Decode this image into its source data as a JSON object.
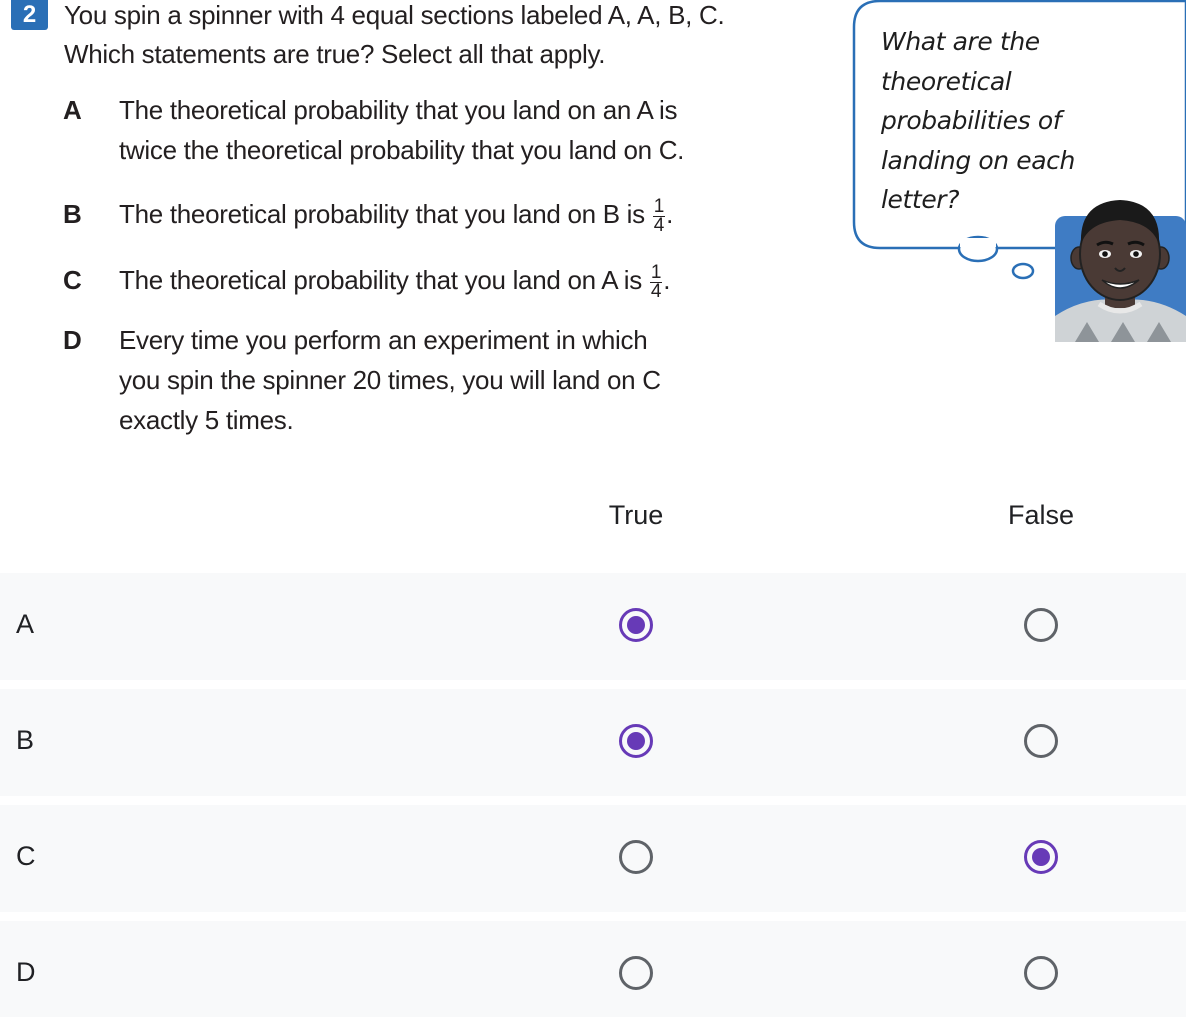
{
  "question": {
    "number": "2",
    "stem_line1": "You spin a spinner with 4 equal sections labeled A, A, B, C.",
    "stem_line2": "Which statements are true? Select all that apply.",
    "options": [
      {
        "letter": "A",
        "line1": "The theoretical probability that you land on an A is",
        "line2": "twice the theoretical probability that you land on C."
      },
      {
        "letter": "B",
        "text": "The theoretical probability that you land on B is",
        "frac_num": "1",
        "frac_den": "4",
        "suffix": "."
      },
      {
        "letter": "C",
        "text": "The theoretical probability that you land on A is",
        "frac_num": "1",
        "frac_den": "4",
        "suffix": "."
      },
      {
        "letter": "D",
        "line1": "Every time you perform an experiment in which",
        "line2": "you spin the spinner 20 times, you will land on C",
        "line3": "exactly 5 times."
      }
    ],
    "bubble": {
      "line1": "What are the",
      "line2": "theoretical",
      "line3": "probabilities of",
      "line4": "landing on each",
      "line5": "letter?"
    }
  },
  "grid": {
    "columns": [
      "True",
      "False"
    ],
    "rows": [
      {
        "label": "A",
        "selected": "True"
      },
      {
        "label": "B",
        "selected": "True"
      },
      {
        "label": "C",
        "selected": "False"
      },
      {
        "label": "D",
        "selected": null
      }
    ],
    "accent_color": "#673ab7",
    "row_background": "#f8f9fa"
  }
}
